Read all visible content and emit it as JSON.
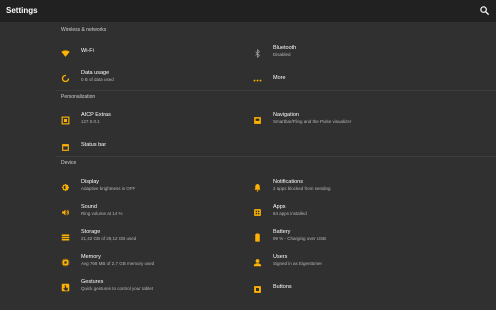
{
  "header": {
    "title": "Settings",
    "search_icon": "search-icon"
  },
  "accent": "#ffb300",
  "sections": {
    "wireless": {
      "title": "Wireless & networks",
      "wifi": {
        "label": "Wi-Fi",
        "icon": "wifi-icon"
      },
      "bluetooth": {
        "label": "Bluetooth",
        "sub": "Disabled",
        "icon": "bluetooth-icon"
      },
      "data_usage": {
        "label": "Data usage",
        "sub": "0 B of data used",
        "icon": "data-usage-icon"
      },
      "more": {
        "label": "More",
        "icon": "more-icon"
      }
    },
    "personalization": {
      "title": "Personalization",
      "aicp": {
        "label": "AICP Extras",
        "sub": "127.0.0.1",
        "icon": "aicp-icon"
      },
      "navigation": {
        "label": "Navigation",
        "sub": "Smartbar/Fling and the Pulse visualizer",
        "icon": "navigation-icon"
      },
      "status_bar": {
        "label": "Status bar",
        "icon": "status-bar-icon"
      }
    },
    "device": {
      "title": "Device",
      "display": {
        "label": "Display",
        "sub": "Adaptive brightness is OFF",
        "icon": "display-icon"
      },
      "notifications": {
        "label": "Notifications",
        "sub": "2 apps blocked from sending",
        "icon": "bell-icon"
      },
      "sound": {
        "label": "Sound",
        "sub": "Ring volume at 14 %",
        "icon": "volume-icon"
      },
      "apps": {
        "label": "Apps",
        "sub": "84 apps installed",
        "icon": "apps-icon"
      },
      "storage": {
        "label": "Storage",
        "sub": "21,42 GB of 29,12 GB used",
        "icon": "storage-icon"
      },
      "battery": {
        "label": "Battery",
        "sub": "99 % - Charging over USB",
        "icon": "battery-icon"
      },
      "memory": {
        "label": "Memory",
        "sub": "Avg 768 MB of 2,7 GB memory used",
        "icon": "memory-icon"
      },
      "users": {
        "label": "Users",
        "sub": "Signed in as Eigentümer",
        "icon": "user-icon"
      },
      "gestures": {
        "label": "Gestures",
        "sub": "Quick gestures to control your tablet",
        "icon": "gestures-icon"
      },
      "buttons": {
        "label": "Buttons",
        "icon": "buttons-icon"
      }
    }
  }
}
